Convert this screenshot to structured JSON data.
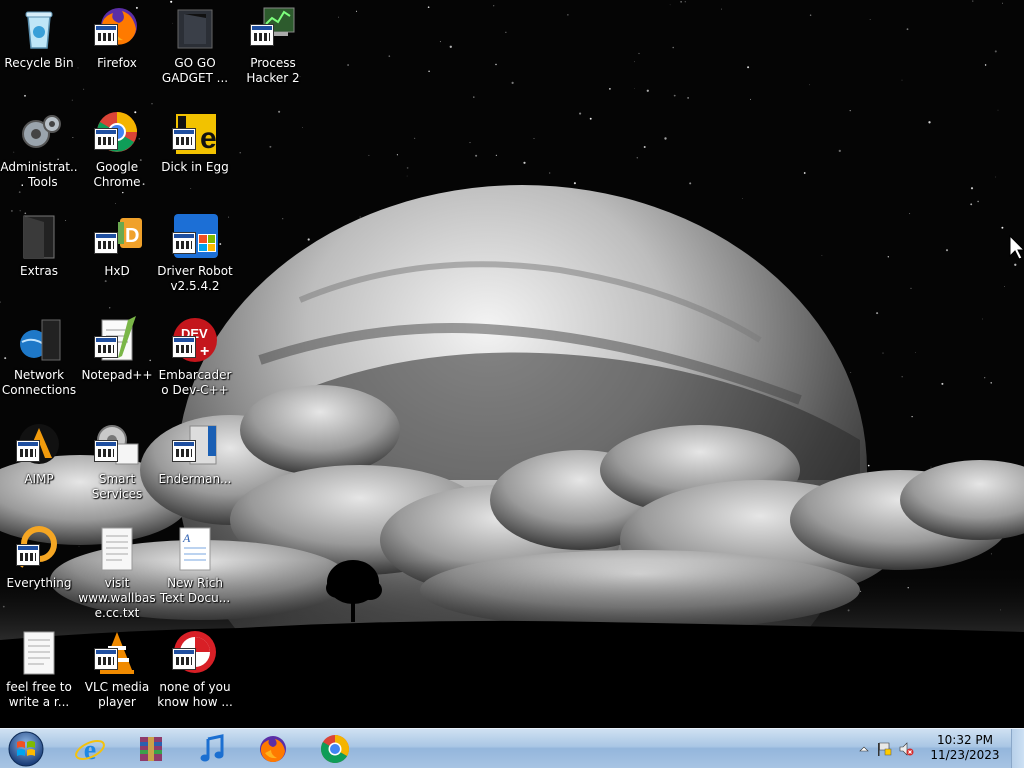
{
  "desktop": {
    "icons": [
      {
        "id": "recycle-bin",
        "label": "Recycle Bin"
      },
      {
        "id": "firefox",
        "label": "Firefox"
      },
      {
        "id": "go-go-gadget",
        "label": "GO GO GADGET ..."
      },
      {
        "id": "process-hacker",
        "label": "Process Hacker 2"
      },
      {
        "id": "admin-tools",
        "label": "Administrat... Tools"
      },
      {
        "id": "google-chrome",
        "label": "Google Chrome"
      },
      {
        "id": "dick-in-egg",
        "label": "Dick in Egg"
      },
      {
        "id": "extras",
        "label": "Extras"
      },
      {
        "id": "hxd",
        "label": "HxD"
      },
      {
        "id": "driver-robot",
        "label": "Driver Robot v2.5.4.2"
      },
      {
        "id": "network-connections",
        "label": "Network Connections"
      },
      {
        "id": "notepad-plus",
        "label": "Notepad++"
      },
      {
        "id": "embarcadero",
        "label": "Embarcadero Dev-C++"
      },
      {
        "id": "aimp",
        "label": "AIMP"
      },
      {
        "id": "smart-services",
        "label": "Smart Services"
      },
      {
        "id": "enderman",
        "label": "Enderman..."
      },
      {
        "id": "everything",
        "label": "Everything"
      },
      {
        "id": "visit-wallbase",
        "label": "visit www.wallbas e.cc.txt"
      },
      {
        "id": "new-rich-text",
        "label": "New Rich Text Docu..."
      },
      {
        "id": "feel-free",
        "label": "feel free to write a r..."
      },
      {
        "id": "vlc",
        "label": "VLC media player"
      },
      {
        "id": "none-of-you",
        "label": "none of you know how ..."
      }
    ]
  },
  "taskbar": {
    "pinned": [
      {
        "id": "internet-explorer",
        "icon": "internet-explorer-icon"
      },
      {
        "id": "winrar",
        "icon": "winrar-icon"
      },
      {
        "id": "itunes",
        "icon": "music-note-icon"
      },
      {
        "id": "firefox",
        "icon": "firefox-icon"
      },
      {
        "id": "chrome",
        "icon": "chrome-icon"
      }
    ],
    "clock": {
      "time": "10:32 PM",
      "date": "11/23/2023"
    }
  },
  "colors": {
    "taskbar": "#a9c6e4",
    "label_text": "#ffffff"
  }
}
